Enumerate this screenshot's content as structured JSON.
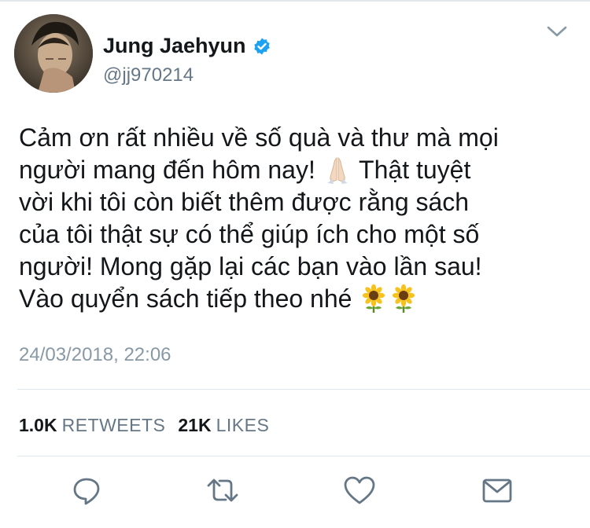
{
  "author": {
    "display_name": "Jung Jaehyun",
    "handle": "@jj970214",
    "verified": true
  },
  "tweet": {
    "lines": [
      "Cảm ơn rất nhiều về số quà và thư mà mọi",
      "người mang đến hôm nay! ",
      " Thật tuyệt",
      "vời khi tôi còn biết thêm được rằng sách",
      "của tôi thật sự có thể giúp ích cho một số",
      "người! Mong gặp lại các bạn vào lần sau!",
      "Vào quyển sách tiếp theo nhé "
    ],
    "emojis": [
      "folded-hands",
      "sunflower",
      "sunflower"
    ]
  },
  "timestamp": "24/03/2018, 22:06",
  "stats": {
    "retweets_count": "1.0K",
    "retweets_label": "RETWEETS",
    "likes_count": "21K",
    "likes_label": "LIKES"
  },
  "icons": {
    "reply": "reply-icon",
    "retweet": "retweet-icon",
    "like": "like-icon",
    "message": "message-icon",
    "menu": "chevron-down-icon",
    "verified": "verified-badge-icon"
  },
  "colors": {
    "verified_blue": "#1da1f2",
    "secondary_text": "#657786",
    "icon_gray": "#657786",
    "divider": "#e1e8ed"
  }
}
